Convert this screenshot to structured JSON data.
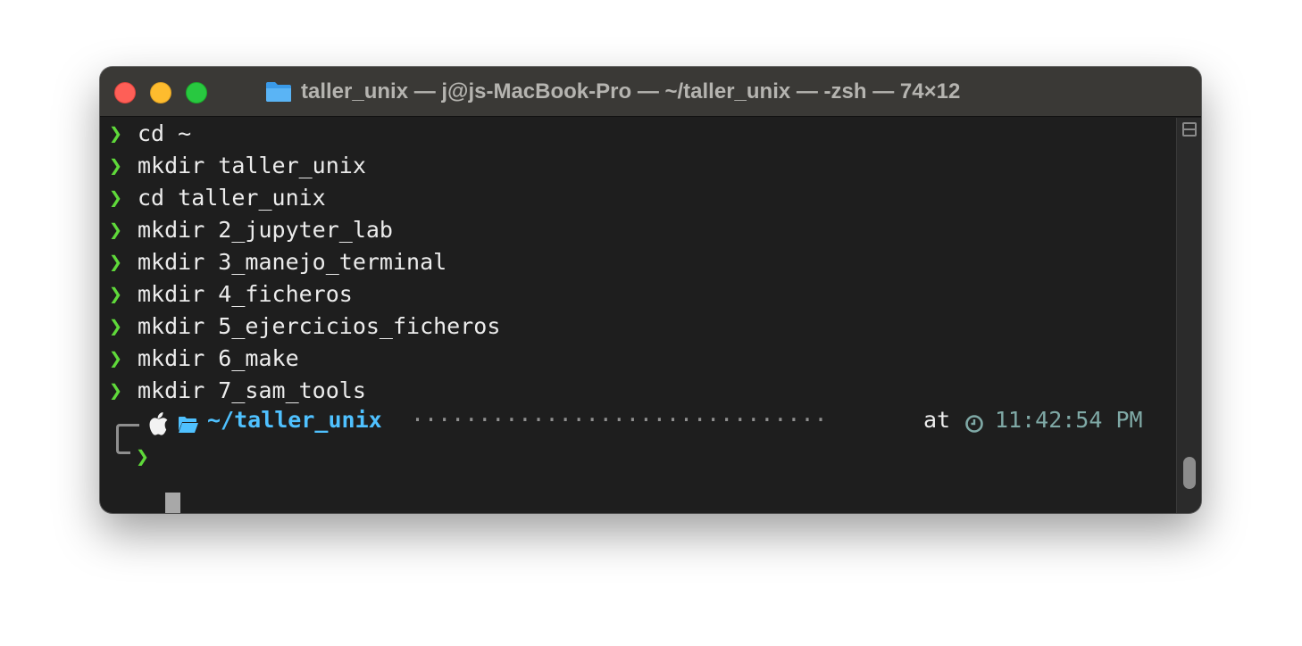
{
  "window": {
    "title": "taller_unix — j@js-MacBook-Pro — ~/taller_unix — -zsh — 74×12",
    "title_icon": "folder-icon",
    "buttons": [
      "close",
      "minimize",
      "zoom"
    ]
  },
  "terminal": {
    "prompt_symbol": "❯",
    "history": [
      "cd ~",
      "mkdir taller_unix",
      "cd taller_unix",
      "mkdir 2_jupyter_lab",
      "mkdir 3_manejo_terminal",
      "mkdir 4_ficheros",
      "mkdir 5_ejercicios_ficheros",
      "mkdir 6_make",
      "mkdir 7_sam_tools"
    ],
    "current_prompt": {
      "os_icon": "apple-icon",
      "dir_icon": "folder-open-icon",
      "path": "~/taller_unix",
      "filler": "·······························",
      "at_label": "at",
      "clock_icon": "clock-icon",
      "time": "11:42:54 PM",
      "input_symbol": "❯"
    }
  },
  "colors": {
    "prompt_green": "#5fd93a",
    "path_blue": "#4fc1ff",
    "time_teal": "#7fa9a6",
    "background": "#1e1e1e"
  }
}
